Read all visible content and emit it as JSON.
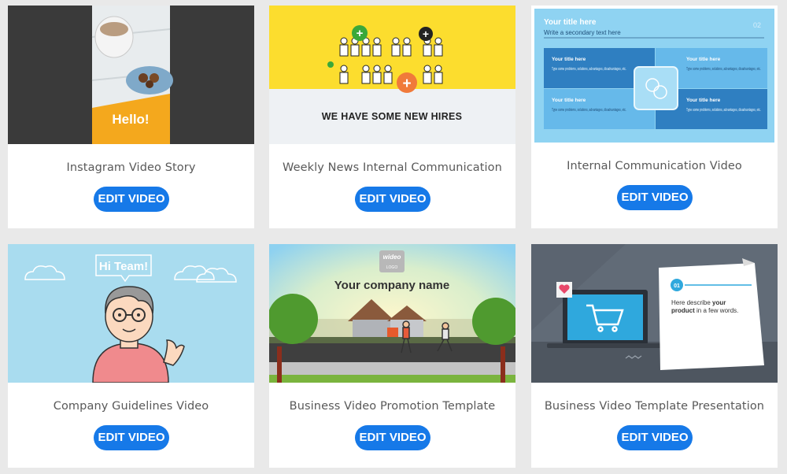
{
  "cards": [
    {
      "title": "Instagram Video Story",
      "button": "EDIT VIDEO",
      "thumb_text": "Hello!"
    },
    {
      "title": "Weekly News Internal Communication",
      "button": "EDIT VIDEO",
      "thumb_text": "WE HAVE SOME NEW HIRES"
    },
    {
      "title": "Internal Communication Video",
      "button": "EDIT VIDEO",
      "thumb": {
        "title": "Your title here",
        "subtitle": "Write a secondary text here",
        "page": "02",
        "box_title": "Your title here",
        "box_text": "Type some problems, solutions, advantages, disadvantages, etc."
      }
    },
    {
      "title": "Company Guidelines Video",
      "button": "EDIT VIDEO",
      "thumb_text": "Hi Team!"
    },
    {
      "title": "Business Video Promotion Template",
      "button": "EDIT VIDEO",
      "thumb": {
        "company": "Your company name",
        "logo": "wideo",
        "logo_sub": "LOGO"
      }
    },
    {
      "title": "Business Video Template Presentation",
      "button": "EDIT VIDEO",
      "thumb": {
        "step": "01",
        "line1": "Here describe ",
        "bold1": "your",
        "bold2": "product",
        "line2": " in a few words."
      }
    }
  ],
  "colors": {
    "button": "#1679e8",
    "background": "#e9e9e9"
  }
}
